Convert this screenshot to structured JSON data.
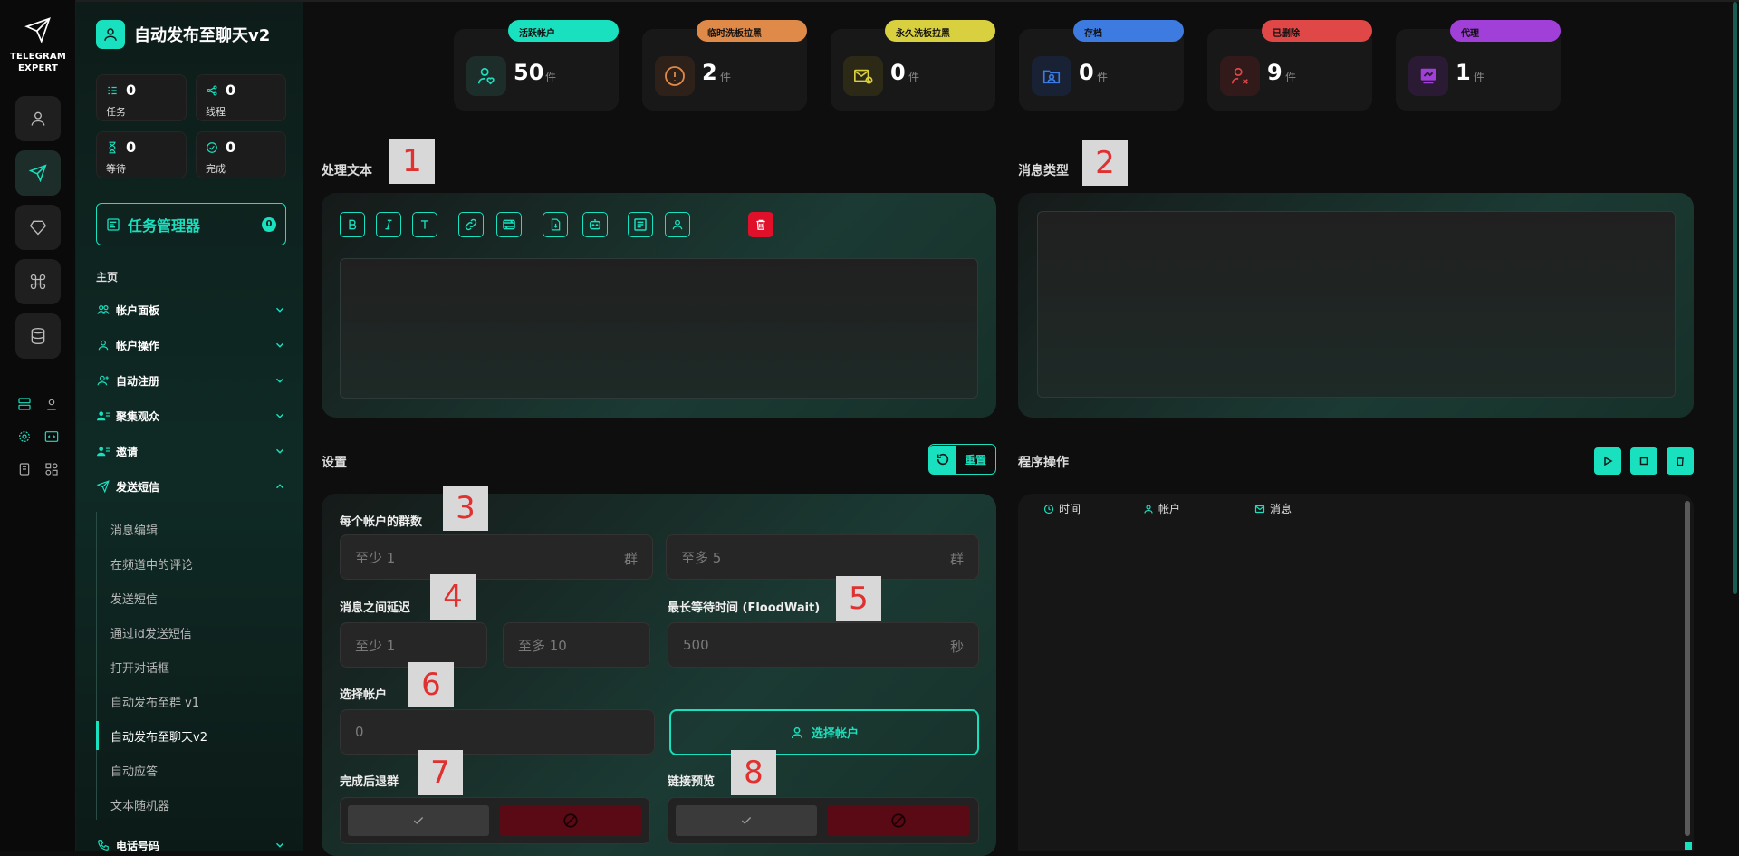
{
  "brand": {
    "name_line1": "TELEGRAM",
    "name_line2": "EXPERT"
  },
  "sidebar": {
    "title": "自动发布至聊天v2",
    "stats": [
      {
        "value": "0",
        "label": "任务"
      },
      {
        "value": "0",
        "label": "线程"
      },
      {
        "value": "0",
        "label": "等待"
      },
      {
        "value": "0",
        "label": "完成"
      }
    ],
    "task_manager": {
      "label": "任务管理器",
      "badge": "0"
    },
    "home_label": "主页",
    "menu": [
      {
        "label": "帐户面板"
      },
      {
        "label": "帐户操作"
      },
      {
        "label": "自动注册"
      },
      {
        "label": "聚集观众"
      },
      {
        "label": "邀请"
      },
      {
        "label": "发送短信"
      }
    ],
    "submenu": [
      {
        "label": "消息编辑"
      },
      {
        "label": "在频道中的评论"
      },
      {
        "label": "发送短信"
      },
      {
        "label": "通过id发送短信"
      },
      {
        "label": "打开对话框"
      },
      {
        "label": "自动发布至群 v1"
      },
      {
        "label": "自动发布至聊天v2"
      },
      {
        "label": "自动应答"
      },
      {
        "label": "文本随机器"
      }
    ],
    "partial_item": "电话号码"
  },
  "top_cards": [
    {
      "pill": "活跃帐户",
      "value": "50",
      "unit": "件",
      "color": "#19e0be"
    },
    {
      "pill": "临时洗板拉黑",
      "value": "2",
      "unit": "件",
      "color": "#e08a4a"
    },
    {
      "pill": "永久洗板拉黑",
      "value": "0",
      "unit": "件",
      "color": "#d9d040"
    },
    {
      "pill": "存档",
      "value": "0",
      "unit": "件",
      "color": "#3d7be0"
    },
    {
      "pill": "已删除",
      "value": "9",
      "unit": "件",
      "color": "#e04848"
    },
    {
      "pill": "代理",
      "value": "1",
      "unit": "件",
      "color": "#a040d8"
    }
  ],
  "sections": {
    "process_text": "处理文本",
    "message_type": "消息类型",
    "settings": "设置",
    "reset": "重置",
    "program_ops": "程序操作"
  },
  "settings": {
    "groups_per_account": {
      "label": "每个帐户的群数",
      "min": "至少  1",
      "max": "至多  5",
      "suffix": "群"
    },
    "delay": {
      "label": "消息之间延迟",
      "min": "至少  1",
      "max": "至多  10"
    },
    "floodwait": {
      "label": "最长等待时间 (FloodWait)",
      "value": "500",
      "suffix": "秒"
    },
    "select_account": {
      "label": "选择帐户",
      "value": "0",
      "button": "选择帐户"
    },
    "leave_after": {
      "label": "完成后退群"
    },
    "link_preview": {
      "label": "链接预览"
    }
  },
  "log": {
    "columns": [
      "时间",
      "帐户",
      "消息"
    ]
  },
  "markers": [
    "1",
    "2",
    "3",
    "4",
    "5",
    "6",
    "7",
    "8"
  ],
  "colors": {
    "accent": "#19e0be",
    "danger": "#e0102a"
  }
}
